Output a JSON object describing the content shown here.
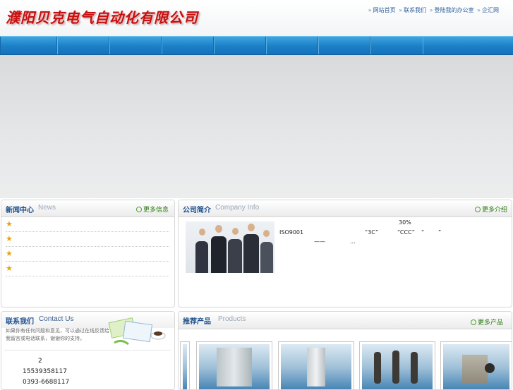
{
  "header": {
    "logo_text": "濮阳贝克电气自动化有限公司",
    "links": [
      {
        "label": "网站首页"
      },
      {
        "label": "联系我们"
      },
      {
        "label": "登陆我的办公室"
      },
      {
        "label": "企汇网"
      }
    ],
    "link_separator": "»"
  },
  "nav": {
    "item_count": 8,
    "accent": "#1b7fc8"
  },
  "news": {
    "title": "新闻中心",
    "subtitle": "News",
    "more": "更多信息",
    "items": [
      "",
      "",
      "",
      ""
    ]
  },
  "company": {
    "title": "公司简介",
    "subtitle": "Company Info",
    "more": "更多介绍",
    "intro_fragments": [
      "30%",
      "ISO9001",
      "“3C”",
      "“CCC”",
      "“",
      "”",
      "——",
      "..."
    ]
  },
  "contact": {
    "title": "联系我们",
    "subtitle": "Contact Us",
    "desc": "如果你有任何问题和意见，可以通过在线反馈给我留言或电话联系，谢谢你的支持。",
    "lines": [
      "2",
      "15539358117",
      "0393-6688117"
    ]
  },
  "products": {
    "title": "推荐产品",
    "subtitle": "Products",
    "more": "更多产品",
    "items": [
      "",
      "",
      "",
      "",
      ""
    ]
  },
  "colors": {
    "brand_red": "#c81010",
    "heading_blue": "#1c4f8c",
    "more_green": "#2b7a12"
  }
}
